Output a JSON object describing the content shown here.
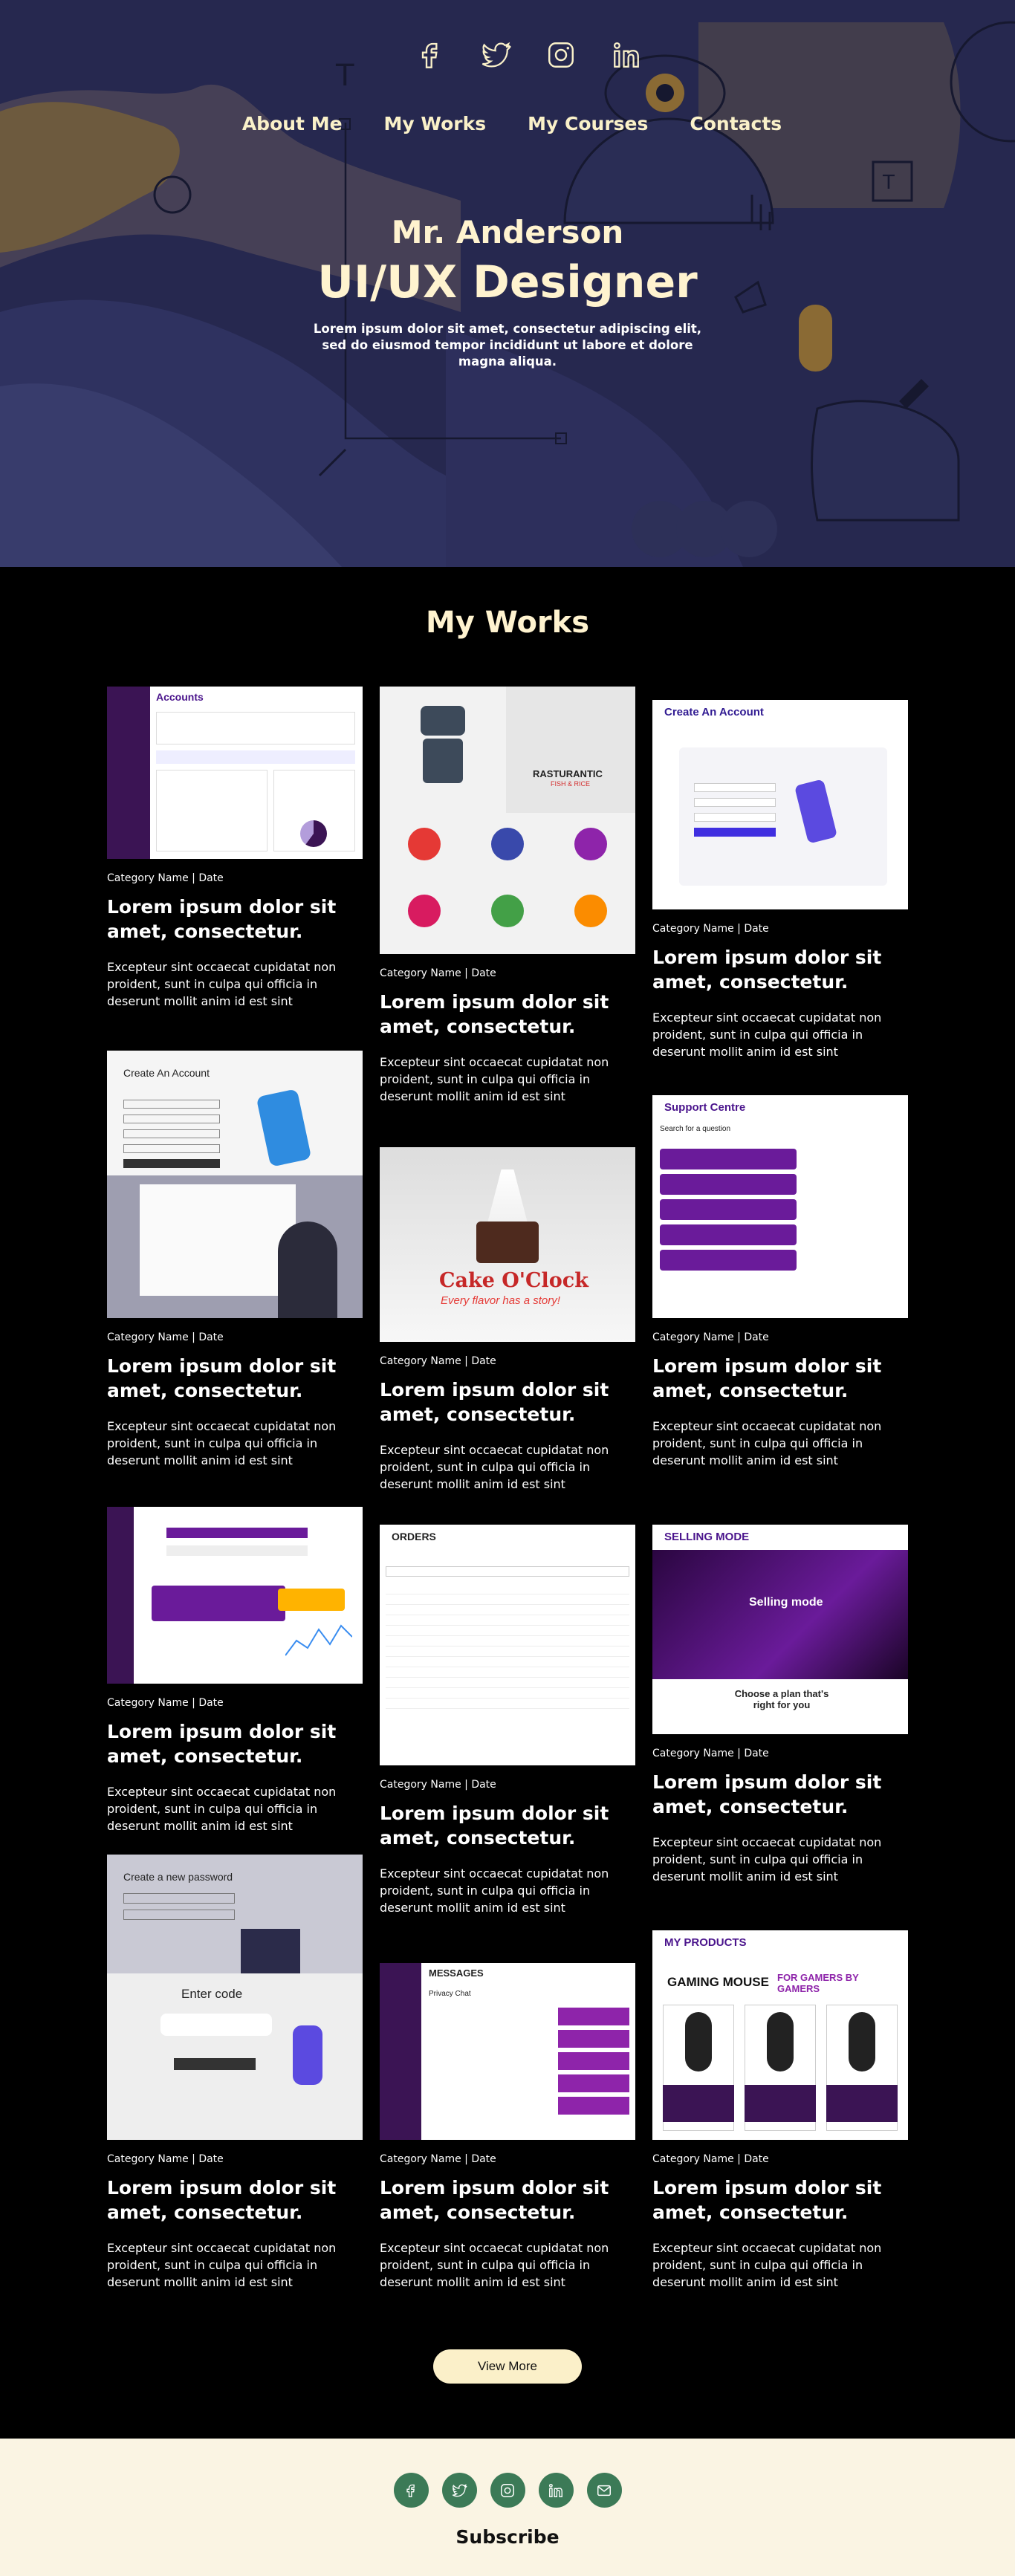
{
  "hero": {
    "name": "Mr. Anderson",
    "title": "UI/UX Designer",
    "description": "Lorem ipsum dolor sit amet, consectetur adipiscing elit, sed do eiusmod tempor incididunt ut labore et dolore magna aliqua."
  },
  "socials": [
    "facebook-icon",
    "twitter-icon",
    "instagram-icon",
    "linkedin-icon"
  ],
  "nav": {
    "about": "About Me",
    "works": "My Works",
    "courses": "My Courses",
    "contacts": "Contacts"
  },
  "works": {
    "heading": "My Works",
    "meta": "Category Name  |  Date",
    "card_title": "Lorem ipsum dolor sit amet, consectetur.",
    "card_desc": "Excepteur sint occaecat cupidatat non proident, sunt in culpa qui officia in deserunt mollit anim id est sint",
    "thumbs": {
      "accounts": "Accounts",
      "create_account": "Create An Account",
      "robot_brand": "RASTURANTIC",
      "robot_sub": "FISH & RICE",
      "cake_brand": "Cake O'Clock",
      "cake_tag": "Every flavor has a story!",
      "support": "Support Centre",
      "support_search": "Search for a question",
      "orders": "ORDERS",
      "selling": "SELLING MODE",
      "selling_hero": "Selling mode",
      "selling_plan": "Choose a plan that's right for you",
      "new_password": "Create a new password",
      "enter_code": "Enter code",
      "messages": "MESSAGES",
      "messages_chat": "Privacy Chat",
      "products": "MY PRODUCTS",
      "products_hero": "GAMING MOUSE",
      "products_tag": "FOR GAMERS BY GAMERS"
    },
    "view_more": "View More"
  },
  "footer": {
    "icons": [
      "facebook-icon",
      "twitter-icon",
      "instagram-icon",
      "linkedin-icon",
      "mail-icon"
    ],
    "subscribe": "Subscribe"
  },
  "colors": {
    "hero_bg": "#26284f",
    "accent_cream": "#fff3cf",
    "footer_bg": "#faf4e3",
    "footer_icon": "#3c7a57",
    "purple": "#6a1b9a"
  }
}
